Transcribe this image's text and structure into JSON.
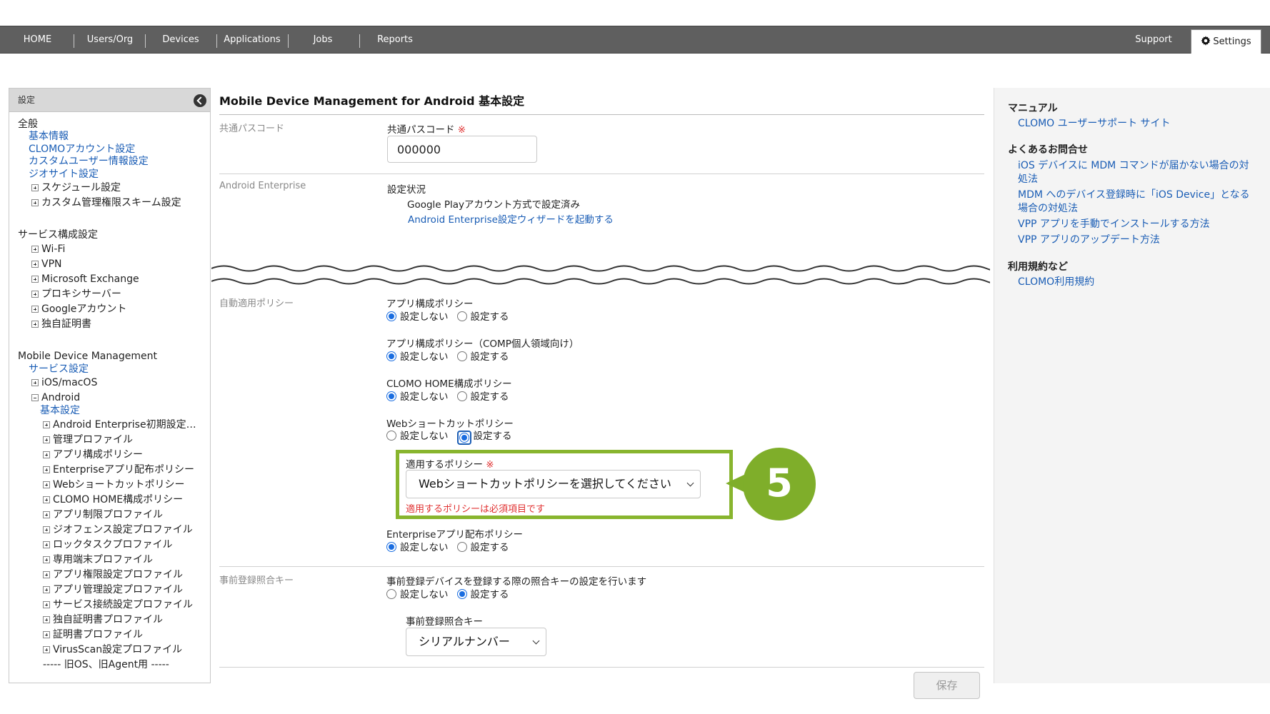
{
  "nav": {
    "items": [
      "HOME",
      "Users/Org",
      "Devices",
      "Applications",
      "Jobs",
      "Reports"
    ],
    "support": "Support",
    "settings": "Settings"
  },
  "sidebar": {
    "header": "設定",
    "rows": [
      {
        "text": "全般",
        "type": "heading"
      },
      {
        "text": "基本情報",
        "type": "link"
      },
      {
        "text": "CLOMOアカウント設定",
        "type": "link"
      },
      {
        "text": "カスタムユーザー情報設定",
        "type": "link"
      },
      {
        "text": "ジオサイト設定",
        "type": "link"
      },
      {
        "text": "スケジュール設定",
        "type": "plus"
      },
      {
        "text": "カスタム管理権限スキーム設定",
        "type": "plus"
      },
      {
        "text": "サービス構成設定",
        "type": "heading"
      },
      {
        "text": "Wi-Fi",
        "type": "plus"
      },
      {
        "text": "VPN",
        "type": "plus"
      },
      {
        "text": "Microsoft Exchange",
        "type": "plus"
      },
      {
        "text": "プロキシサーバー",
        "type": "plus"
      },
      {
        "text": "Googleアカウント",
        "type": "plus"
      },
      {
        "text": "独自証明書",
        "type": "plus"
      },
      {
        "text": "Mobile Device Management",
        "type": "heading"
      },
      {
        "text": "サービス設定",
        "type": "link"
      },
      {
        "text": "iOS/macOS",
        "type": "plus"
      },
      {
        "text": "Android",
        "type": "minus"
      },
      {
        "text": "基本設定",
        "type": "link"
      },
      {
        "text": "Android Enterprise初期設定…",
        "type": "plus"
      },
      {
        "text": "管理プロファイル",
        "type": "plus"
      },
      {
        "text": "アプリ構成ポリシー",
        "type": "plus"
      },
      {
        "text": "Enterpriseアプリ配布ポリシー",
        "type": "plus"
      },
      {
        "text": "Webショートカットポリシー",
        "type": "plus"
      },
      {
        "text": "CLOMO HOME構成ポリシー",
        "type": "plus"
      },
      {
        "text": "アプリ制限プロファイル",
        "type": "plus"
      },
      {
        "text": "ジオフェンス設定プロファイル",
        "type": "plus"
      },
      {
        "text": "ロックタスクプロファイル",
        "type": "plus"
      },
      {
        "text": "専用端末プロファイル",
        "type": "plus"
      },
      {
        "text": "アプリ権限設定プロファイル",
        "type": "plus"
      },
      {
        "text": "アプリ管理設定プロファイル",
        "type": "plus"
      },
      {
        "text": "サービス接続設定プロファイル",
        "type": "plus"
      },
      {
        "text": "独自証明書プロファイル",
        "type": "plus"
      },
      {
        "text": "証明書プロファイル",
        "type": "plus"
      },
      {
        "text": "VirusScan設定プロファイル",
        "type": "plus"
      },
      {
        "text": "----- 旧OS、旧Agent用 -----",
        "type": "plain"
      }
    ]
  },
  "main": {
    "title": "Mobile Device Management for Android 基本設定",
    "passcode": {
      "section": "共通パスコード",
      "label": "共通パスコード",
      "required": "※",
      "value": "000000"
    },
    "enterprise": {
      "section": "Android Enterprise",
      "status_label": "設定状況",
      "status_value": "Google Playアカウント方式で設定済み",
      "wizard_link": "Android Enterprise設定ウィザードを起動する"
    },
    "auto_policy": {
      "section": "自動適用ポリシー",
      "opt_off": "設定しない",
      "opt_on": "設定する",
      "policies": [
        {
          "label": "アプリ構成ポリシー",
          "selected": "off"
        },
        {
          "label": "アプリ構成ポリシー（COMP個人領域向け）",
          "selected": "off"
        },
        {
          "label": "CLOMO HOME構成ポリシー",
          "selected": "off"
        },
        {
          "label": "Webショートカットポリシー",
          "selected": "on"
        },
        {
          "label": "Enterpriseアプリ配布ポリシー",
          "selected": "off"
        }
      ],
      "apply_label": "適用するポリシー",
      "apply_required": "※",
      "apply_select": "Webショートカットポリシーを選択してください",
      "apply_error": "適用するポリシーは必須項目です"
    },
    "prereg": {
      "section": "事前登録照合キー",
      "description": "事前登録デバイスを登録する際の照合キーの設定を行います",
      "opt_off": "設定しない",
      "opt_on": "設定する",
      "selected": "on",
      "key_label": "事前登録照合キー",
      "key_value": "シリアルナンバー"
    },
    "save": "保存",
    "step_number": "5"
  },
  "right_panel": {
    "manual_heading": "マニュアル",
    "manual_link": "CLOMO ユーザーサポート サイト",
    "faq_heading": "よくあるお問合せ",
    "faq_links": [
      [
        "iOS デバイスに MDM コマンドが届かない場合の対",
        "処法"
      ],
      [
        "MDM へのデバイス登録時に「iOS Device」となる",
        "場合の対処法"
      ],
      [
        "VPP アプリを手動でインストールする方法"
      ],
      [
        "VPP アプリのアップデート方法"
      ]
    ],
    "terms_heading": "利用規約など",
    "terms_link": "CLOMO利用規約"
  },
  "colors": {
    "nav_bg": "#5f5f5f",
    "link": "#1a5db5",
    "radio": "#1a6de0",
    "highlight": "#88b52e",
    "required": "#e03030"
  }
}
